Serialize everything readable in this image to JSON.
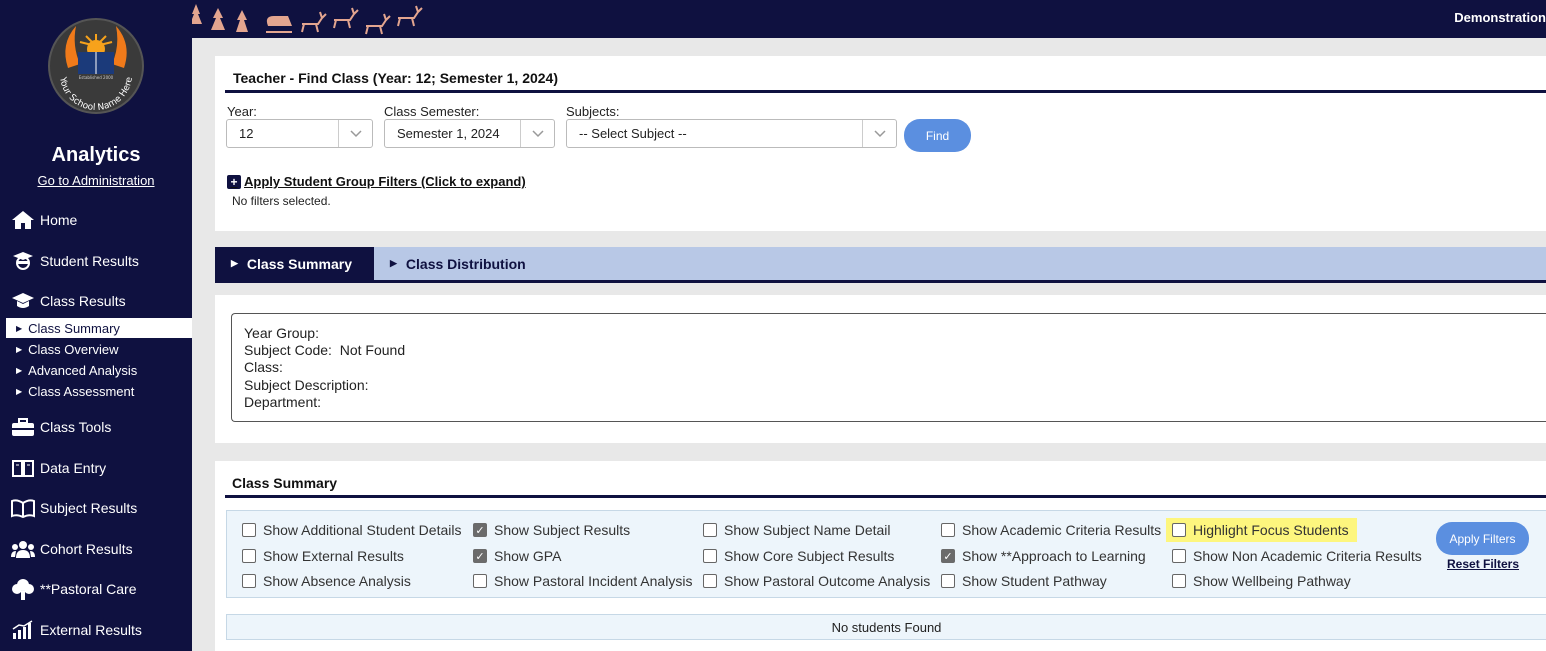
{
  "sidebar": {
    "logo_text": "Your School Name Here",
    "logo_since": "Established 2000",
    "title": "Analytics",
    "admin_link": "Go to Administration",
    "nav": {
      "home": "Home",
      "student_results": "Student Results",
      "class_results": "Class Results",
      "class_tools": "Class Tools",
      "data_entry": "Data Entry",
      "subject_results": "Subject Results",
      "cohort_results": "Cohort Results",
      "pastoral_care": "**Pastoral Care",
      "external_results": "External Results"
    },
    "sub": {
      "class_summary": "Class Summary",
      "class_overview": "Class Overview",
      "advanced_analysis": "Advanced Analysis",
      "class_assessment": "Class Assessment"
    }
  },
  "topbar": {
    "user": "Demonstration"
  },
  "find": {
    "title": "Teacher - Find Class (Year: 12; Semester 1, 2024)",
    "year_label": "Year:",
    "year_value": "12",
    "semester_label": "Class Semester:",
    "semester_value": "Semester 1, 2024",
    "subjects_label": "Subjects:",
    "subjects_value": "-- Select Subject --",
    "find_button": "Find",
    "filters_link": "Apply Student Group Filters (Click to expand)",
    "no_filters": "No filters selected."
  },
  "tabs": {
    "summary": "Class Summary",
    "distribution": "Class Distribution"
  },
  "info": {
    "year_group": "Year Group:",
    "subject_code_label": "Subject Code:",
    "subject_code_value": "Not Found",
    "class": "Class:",
    "subject_description": "Subject Description:",
    "department": "Department:"
  },
  "summary": {
    "title": "Class Summary",
    "filters": {
      "additional_details": "Show Additional Student Details",
      "external_results": "Show External Results",
      "absence": "Show Absence Analysis",
      "subject_results": "Show Subject Results",
      "gpa": "Show GPA",
      "pastoral_incident": "Show Pastoral Incident Analysis",
      "subject_name": "Show Subject Name Detail",
      "core_subject": "Show Core Subject Results",
      "pastoral_outcome": "Show Pastoral Outcome Analysis",
      "academic_criteria": "Show Academic Criteria Results",
      "approach": "Show **Approach to Learning",
      "pathway": "Show Student Pathway",
      "focus": "Highlight Focus Students",
      "non_academic": "Show Non Academic Criteria Results",
      "wellbeing": "Show Wellbeing Pathway"
    },
    "apply_button": "Apply Filters",
    "reset_link": "Reset Filters",
    "empty_message": "No students Found"
  },
  "colors": {
    "navy": "#0f1140",
    "accent_blue": "#5b8fe0",
    "tab_bg": "#b8c8e6",
    "highlight": "#fdf67e"
  }
}
